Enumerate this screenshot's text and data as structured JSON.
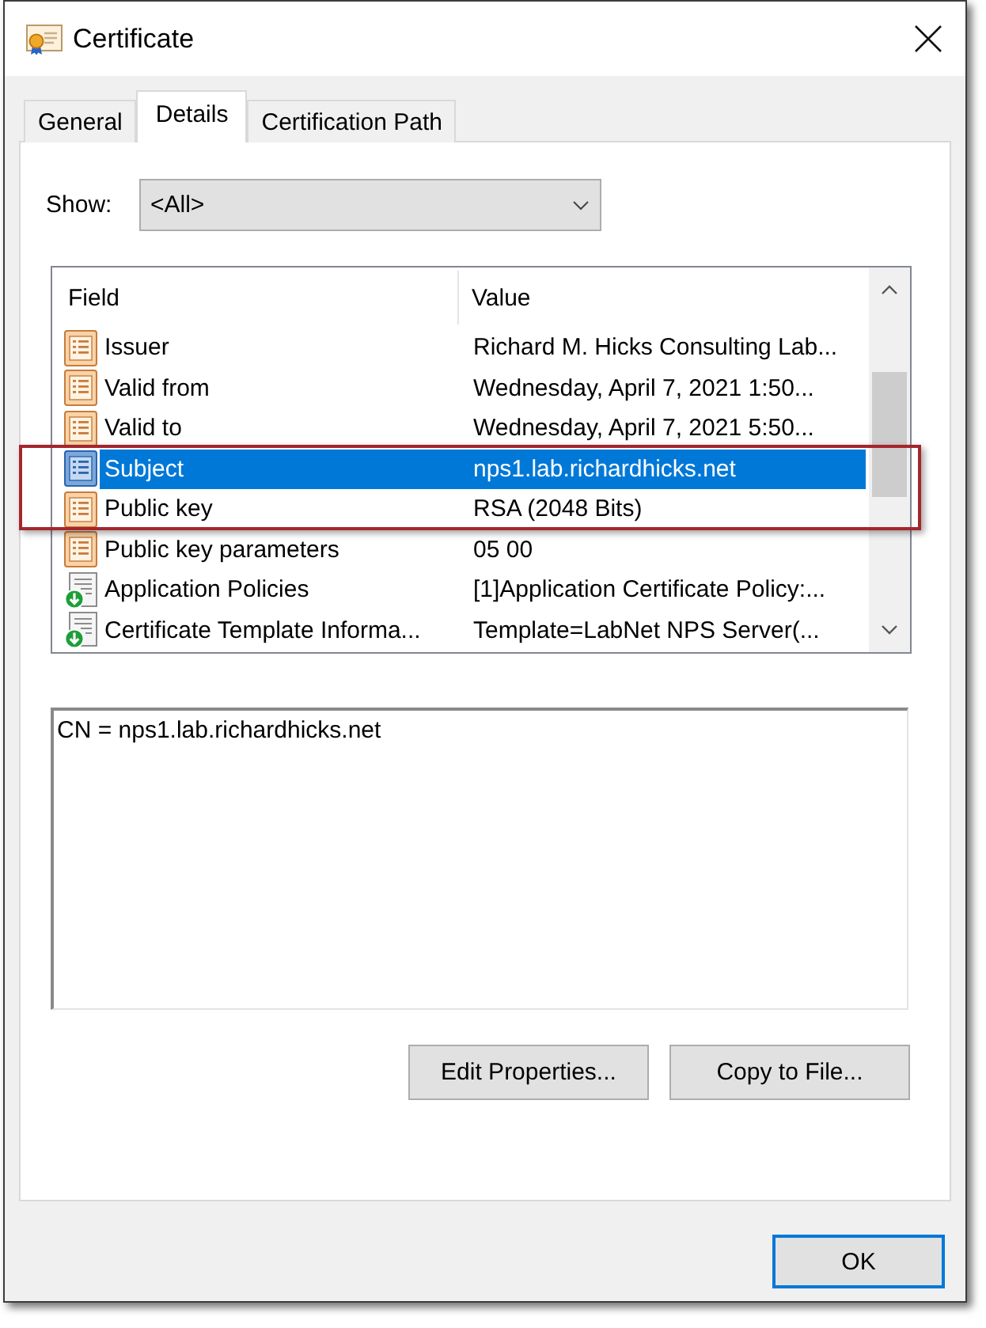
{
  "window": {
    "title": "Certificate"
  },
  "tabs": [
    {
      "label": "General",
      "selected": false
    },
    {
      "label": "Details",
      "selected": true
    },
    {
      "label": "Certification Path",
      "selected": false
    }
  ],
  "show": {
    "label": "Show:",
    "value": "<All>"
  },
  "list": {
    "columns": [
      "Field",
      "Value"
    ],
    "rows": [
      {
        "kind": "field",
        "field": "Issuer",
        "value": "Richard M. Hicks Consulting Lab...",
        "selected": false,
        "annotated": false
      },
      {
        "kind": "field",
        "field": "Valid from",
        "value": "Wednesday, April 7, 2021 1:50...",
        "selected": false,
        "annotated": false
      },
      {
        "kind": "field",
        "field": "Valid to",
        "value": "Wednesday, April 7, 2021 5:50...",
        "selected": false,
        "annotated": false
      },
      {
        "kind": "field",
        "field": "Subject",
        "value": "nps1.lab.richardhicks.net",
        "selected": true,
        "annotated": true
      },
      {
        "kind": "field",
        "field": "Public key",
        "value": "RSA (2048 Bits)",
        "selected": false,
        "annotated": true
      },
      {
        "kind": "field",
        "field": "Public key parameters",
        "value": "05 00",
        "selected": false,
        "annotated": false
      },
      {
        "kind": "extension",
        "field": "Application Policies",
        "value": "[1]Application Certificate Policy:...",
        "selected": false,
        "annotated": false
      },
      {
        "kind": "extension",
        "field": "Certificate Template Informa...",
        "value": "Template=LabNet NPS Server(...",
        "selected": false,
        "annotated": false
      }
    ]
  },
  "detail_text": "CN = nps1.lab.richardhicks.net",
  "buttons": [
    "Edit Properties...",
    "Copy to File..."
  ],
  "ok_button": "OK"
}
